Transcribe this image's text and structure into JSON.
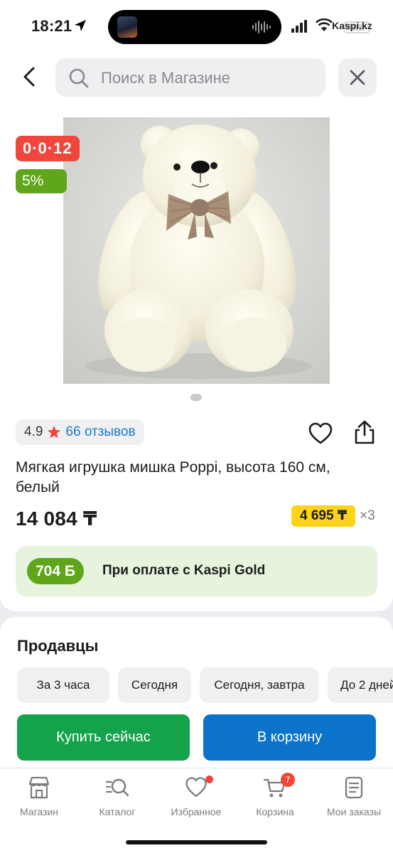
{
  "status_bar": {
    "time": "18:21",
    "carrier": "Kaspi.kz"
  },
  "header": {
    "search_placeholder": "Поиск в Магазине"
  },
  "product": {
    "timer": "0·0·12",
    "discount": "5%",
    "rating": "4.9",
    "reviews": "66 отзывов",
    "title": "Мягкая игрушка мишка Poppi, высота 160 см, белый",
    "price": "14 084 ₸",
    "installment_price": "4 695 ₸",
    "installment_months": "×3",
    "bonus_amount": "704 Б",
    "bonus_text": "При оплате с Kaspi Gold",
    "image_count_shown": 1
  },
  "sellers": {
    "title": "Продавцы",
    "delivery_filters": [
      "За 3 часа",
      "Сегодня",
      "Сегодня, завтра",
      "До 2 дней"
    ],
    "buy_now_label": "Купить сейчас",
    "add_to_cart_label": "В корзину"
  },
  "tab_bar": {
    "items": [
      {
        "label": "Магазин",
        "icon": "store-icon"
      },
      {
        "label": "Каталог",
        "icon": "catalog-search-icon"
      },
      {
        "label": "Избранное",
        "icon": "heart-icon"
      },
      {
        "label": "Корзина",
        "icon": "cart-icon"
      },
      {
        "label": "Мои заказы",
        "icon": "orders-icon"
      }
    ],
    "cart_count": "7"
  },
  "colors": {
    "timer_red": "#f0463c",
    "discount_green": "#5fa61b",
    "installment_yellow": "#ffd31a",
    "buy_green": "#14a34a",
    "cart_blue": "#0b73c9",
    "link_blue": "#1a7bc9"
  }
}
